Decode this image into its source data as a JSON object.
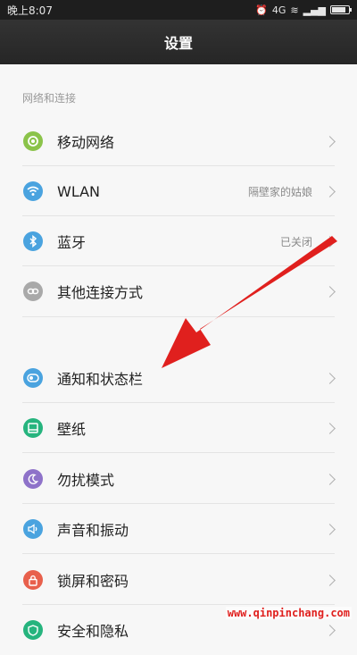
{
  "status_bar": {
    "time": "晚上8:07",
    "network_label": "4G"
  },
  "header": {
    "title": "设置"
  },
  "sections": [
    {
      "title": "网络和连接"
    }
  ],
  "items": [
    {
      "label": "移动网络",
      "value": "",
      "icon": "mobile-network-icon",
      "color": "#8bc34a"
    },
    {
      "label": "WLAN",
      "value": "隔壁家的姑娘",
      "icon": "wifi-icon",
      "color": "#4aa3df"
    },
    {
      "label": "蓝牙",
      "value": "已关闭",
      "icon": "bluetooth-icon",
      "color": "#4aa3df"
    },
    {
      "label": "其他连接方式",
      "value": "",
      "icon": "link-icon",
      "color": "#a9a9a9"
    },
    {
      "label": "通知和状态栏",
      "value": "",
      "icon": "notification-toggle-icon",
      "color": "#4aa3df"
    },
    {
      "label": "壁纸",
      "value": "",
      "icon": "wallpaper-icon",
      "color": "#26b47e"
    },
    {
      "label": "勿扰模式",
      "value": "",
      "icon": "moon-icon",
      "color": "#8e72c9"
    },
    {
      "label": "声音和振动",
      "value": "",
      "icon": "speaker-icon",
      "color": "#4aa3df"
    },
    {
      "label": "锁屏和密码",
      "value": "",
      "icon": "lock-icon",
      "color": "#e8604c"
    },
    {
      "label": "安全和隐私",
      "value": "",
      "icon": "shield-icon",
      "color": "#26b47e"
    }
  ],
  "watermark": "www.qinpinchang.com",
  "annotation": {
    "arrow_color": "#e0201e"
  }
}
